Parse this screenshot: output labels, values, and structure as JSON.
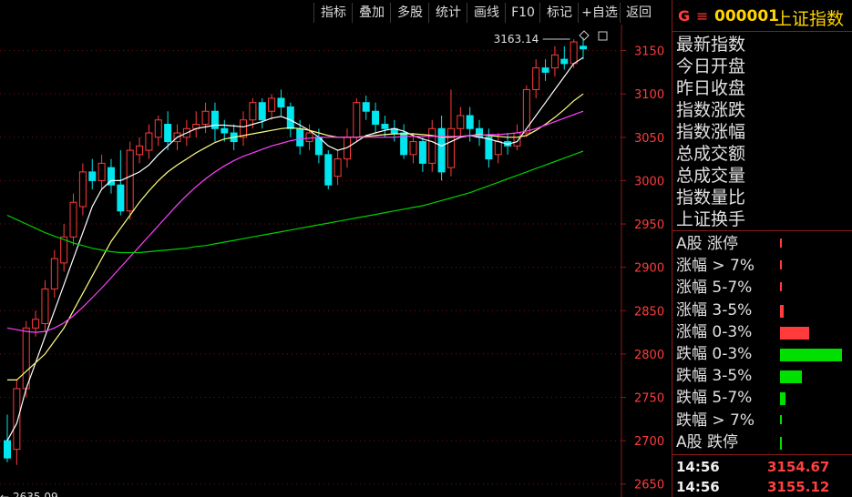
{
  "toolbar": {
    "buttons": [
      "指标",
      "叠加",
      "多股",
      "统计",
      "画线",
      "F10",
      "标记",
      "+自选",
      "返回"
    ]
  },
  "sidebar": {
    "marker": "G",
    "menu_icon": "menu-icon",
    "code": "000001",
    "name": "上证指数",
    "fields": [
      "最新指数",
      "今日开盘",
      "昨日收盘",
      "指数涨跌",
      "指数涨幅",
      "总成交额",
      "总成交量",
      "指数量比",
      "上证换手"
    ],
    "distribution": [
      {
        "label": "A股 涨停",
        "value": 0.01,
        "color": "#ff3b3b"
      },
      {
        "label": "涨幅 > 7%",
        "value": 0.01,
        "color": "#ff3b3b"
      },
      {
        "label": "涨幅 5-7%",
        "value": 0.01,
        "color": "#ff3b3b"
      },
      {
        "label": "涨幅 3-5%",
        "value": 0.05,
        "color": "#ff3b3b"
      },
      {
        "label": "涨幅 0-3%",
        "value": 0.4,
        "color": "#ff3b3b"
      },
      {
        "label": "跌幅 0-3%",
        "value": 0.85,
        "color": "#00e000"
      },
      {
        "label": "跌幅 3-5%",
        "value": 0.3,
        "color": "#00e000"
      },
      {
        "label": "跌幅 5-7%",
        "value": 0.07,
        "color": "#00e000"
      },
      {
        "label": "跌幅 > 7%",
        "value": 0.01,
        "color": "#00e000"
      },
      {
        "label": "A股 跌停",
        "value": 0.03,
        "color": "#00e000"
      }
    ],
    "ticks": [
      {
        "time": "14:56",
        "price": "3154.67"
      },
      {
        "time": "14:56",
        "price": "3155.12"
      }
    ]
  },
  "chart_data": {
    "type": "candlestick",
    "ylim": [
      2635,
      3180
    ],
    "yticks": [
      2650,
      2700,
      2750,
      2800,
      2850,
      2900,
      2950,
      3000,
      3050,
      3100,
      3150
    ],
    "ytick_labels": [
      "2650",
      "2700",
      "2750",
      "2800",
      "2850",
      "2900",
      "2950",
      "3000",
      "3050",
      "3100",
      "3150"
    ],
    "annotations": [
      {
        "text": "3163.14",
        "value": 3163.14
      },
      {
        "text": "2635.09",
        "value": 2635.09
      }
    ],
    "candles": [
      [
        2700,
        2680,
        2730,
        2675
      ],
      [
        2690,
        2760,
        2770,
        2672
      ],
      [
        2760,
        2830,
        2838,
        2750
      ],
      [
        2830,
        2840,
        2850,
        2820
      ],
      [
        2835,
        2875,
        2885,
        2825
      ],
      [
        2875,
        2910,
        2920,
        2865
      ],
      [
        2905,
        2935,
        2950,
        2895
      ],
      [
        2935,
        2975,
        2985,
        2925
      ],
      [
        2970,
        3010,
        3020,
        2960
      ],
      [
        3010,
        3000,
        3025,
        2990
      ],
      [
        3000,
        3020,
        3030,
        2990
      ],
      [
        3015,
        2995,
        3025,
        2985
      ],
      [
        2995,
        2965,
        3035,
        2960
      ],
      [
        2965,
        3035,
        3045,
        2955
      ],
      [
        3030,
        3040,
        3050,
        3020
      ],
      [
        3035,
        3055,
        3065,
        3025
      ],
      [
        3050,
        3070,
        3075,
        3040
      ],
      [
        3065,
        3045,
        3080,
        3035
      ],
      [
        3045,
        3055,
        3065,
        3035
      ],
      [
        3050,
        3060,
        3070,
        3040
      ],
      [
        3060,
        3065,
        3080,
        3050
      ],
      [
        3065,
        3080,
        3090,
        3055
      ],
      [
        3080,
        3060,
        3090,
        3045
      ],
      [
        3060,
        3055,
        3070,
        3045
      ],
      [
        3055,
        3045,
        3065,
        3035
      ],
      [
        3050,
        3070,
        3080,
        3040
      ],
      [
        3070,
        3090,
        3095,
        3060
      ],
      [
        3090,
        3070,
        3095,
        3060
      ],
      [
        3080,
        3095,
        3100,
        3070
      ],
      [
        3095,
        3085,
        3105,
        3075
      ],
      [
        3085,
        3060,
        3090,
        3050
      ],
      [
        3060,
        3040,
        3070,
        3030
      ],
      [
        3045,
        3055,
        3065,
        3035
      ],
      [
        3050,
        3030,
        3060,
        3020
      ],
      [
        3030,
        2995,
        3035,
        2990
      ],
      [
        3005,
        3025,
        3035,
        2995
      ],
      [
        3025,
        3050,
        3060,
        3015
      ],
      [
        3050,
        3090,
        3095,
        3045
      ],
      [
        3090,
        3080,
        3098,
        3070
      ],
      [
        3080,
        3065,
        3090,
        3055
      ],
      [
        3065,
        3060,
        3075,
        3050
      ],
      [
        3060,
        3055,
        3070,
        3045
      ],
      [
        3055,
        3030,
        3065,
        3025
      ],
      [
        3030,
        3045,
        3055,
        3020
      ],
      [
        3045,
        3020,
        3050,
        3010
      ],
      [
        3020,
        3060,
        3070,
        3010
      ],
      [
        3060,
        3010,
        3075,
        3000
      ],
      [
        3015,
        3060,
        3105,
        3005
      ],
      [
        3060,
        3075,
        3085,
        3050
      ],
      [
        3075,
        3060,
        3085,
        3045
      ],
      [
        3060,
        3050,
        3070,
        3040
      ],
      [
        3050,
        3025,
        3060,
        3015
      ],
      [
        3030,
        3045,
        3055,
        3020
      ],
      [
        3045,
        3040,
        3055,
        3030
      ],
      [
        3040,
        3055,
        3065,
        3035
      ],
      [
        3055,
        3105,
        3110,
        3050
      ],
      [
        3105,
        3130,
        3140,
        3095
      ],
      [
        3130,
        3125,
        3140,
        3115
      ],
      [
        3130,
        3145,
        3155,
        3120
      ],
      [
        3140,
        3135,
        3155,
        3128
      ],
      [
        3135,
        3160,
        3163.14,
        3130
      ],
      [
        3155,
        3152,
        3165,
        3140
      ]
    ],
    "ma_series": [
      {
        "color": "#ffffff",
        "values": [
          2700,
          2720,
          2760,
          2790,
          2820,
          2850,
          2880,
          2910,
          2940,
          2970,
          2990,
          3000,
          3000,
          3005,
          3010,
          3018,
          3030,
          3040,
          3050,
          3055,
          3060,
          3062,
          3064,
          3064,
          3063,
          3062,
          3065,
          3068,
          3072,
          3074,
          3070,
          3064,
          3058,
          3050,
          3040,
          3035,
          3038,
          3045,
          3052,
          3055,
          3058,
          3060,
          3057,
          3052,
          3048,
          3045,
          3040,
          3045,
          3050,
          3052,
          3050,
          3048,
          3045,
          3042,
          3045,
          3060,
          3075,
          3090,
          3105,
          3120,
          3135,
          3142
        ]
      },
      {
        "color": "#ffff80",
        "values": [
          2770,
          2770,
          2780,
          2790,
          2800,
          2815,
          2830,
          2850,
          2870,
          2890,
          2910,
          2930,
          2945,
          2960,
          2975,
          2988,
          3000,
          3010,
          3018,
          3025,
          3032,
          3038,
          3044,
          3048,
          3050,
          3052,
          3054,
          3056,
          3058,
          3060,
          3061,
          3060,
          3058,
          3055,
          3052,
          3050,
          3050,
          3050,
          3051,
          3052,
          3053,
          3054,
          3054,
          3054,
          3053,
          3052,
          3050,
          3050,
          3051,
          3052,
          3053,
          3052,
          3051,
          3050,
          3050,
          3052,
          3058,
          3065,
          3073,
          3082,
          3092,
          3100
        ]
      },
      {
        "color": "#ff40ff",
        "values": [
          2830,
          2828,
          2826,
          2825,
          2826,
          2830,
          2836,
          2844,
          2854,
          2865,
          2876,
          2888,
          2900,
          2912,
          2924,
          2936,
          2948,
          2960,
          2972,
          2983,
          2993,
          3002,
          3010,
          3017,
          3023,
          3028,
          3032,
          3036,
          3040,
          3043,
          3046,
          3048,
          3049,
          3050,
          3050,
          3050,
          3050,
          3050,
          3050,
          3050,
          3050,
          3050,
          3051,
          3051,
          3051,
          3051,
          3051,
          3051,
          3051,
          3052,
          3052,
          3053,
          3053,
          3054,
          3055,
          3057,
          3060,
          3064,
          3068,
          3072,
          3076,
          3080
        ]
      },
      {
        "color": "#00d000",
        "values": [
          2960,
          2955,
          2950,
          2945,
          2940,
          2936,
          2932,
          2928,
          2925,
          2922,
          2920,
          2918,
          2917,
          2917,
          2917,
          2918,
          2919,
          2920,
          2921,
          2922,
          2924,
          2925,
          2927,
          2929,
          2931,
          2933,
          2935,
          2937,
          2939,
          2941,
          2943,
          2945,
          2947,
          2949,
          2951,
          2953,
          2955,
          2957,
          2959,
          2961,
          2963,
          2965,
          2967,
          2969,
          2971,
          2974,
          2977,
          2980,
          2983,
          2986,
          2990,
          2994,
          2998,
          3002,
          3006,
          3010,
          3014,
          3018,
          3022,
          3026,
          3030,
          3034
        ]
      }
    ]
  }
}
